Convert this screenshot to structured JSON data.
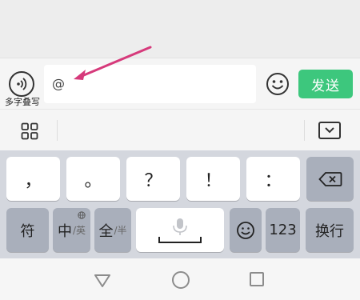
{
  "input_bar": {
    "voice_caption": "多字叠写",
    "input_value": "@",
    "send_label": "发送",
    "send_color": "#3dc77d"
  },
  "keyboard": {
    "row1": [
      {
        "name": "key-comma",
        "label": "，"
      },
      {
        "name": "key-period",
        "label": "。"
      },
      {
        "name": "key-question",
        "label": "？"
      },
      {
        "name": "key-exclaim",
        "label": "！"
      },
      {
        "name": "key-colon",
        "label": "："
      }
    ],
    "row2": {
      "symbol_label": "符",
      "chinese_main": "中",
      "chinese_sub": "/英",
      "full_main": "全",
      "full_sub": "/半",
      "numbers_label": "123",
      "newline_label": "换行"
    }
  },
  "icons": [
    "voice-icon",
    "emoji-icon",
    "grid-icon",
    "collapse-keyboard-icon",
    "backspace-icon",
    "mic-icon",
    "globe-icon",
    "smiley-icon",
    "nav-back-icon",
    "nav-home-icon",
    "nav-recent-icon"
  ],
  "colors": {
    "arrow": "#d63a7b",
    "keyboard_bg": "#d4d7de",
    "dark_key": "#a9afbb"
  }
}
